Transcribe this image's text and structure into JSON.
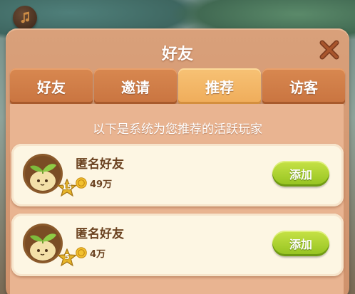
{
  "dialog": {
    "title": "好友",
    "subtitle": "以下是系统为您推荐的活跃玩家"
  },
  "tabs": [
    {
      "label": "好友",
      "active": false
    },
    {
      "label": "邀请",
      "active": false
    },
    {
      "label": "推荐",
      "active": true
    },
    {
      "label": "访客",
      "active": false
    }
  ],
  "players": [
    {
      "name": "匿名好友",
      "level": "15",
      "coins": "49万",
      "add_label": "添加"
    },
    {
      "name": "匿名好友",
      "level": "5",
      "coins": "4万",
      "add_label": "添加"
    }
  ],
  "colors": {
    "panel": "#cf926c",
    "tab": "#c97440",
    "tab_active": "#efac5a",
    "card": "#fdf6e3",
    "add_button": "#93c21f",
    "text_brown": "#6b4220"
  },
  "icons": {
    "music": "music-note-icon",
    "close": "close-icon",
    "coin": "coin-icon",
    "avatar": "sprout-avatar-icon",
    "level": "star-badge-icon"
  }
}
